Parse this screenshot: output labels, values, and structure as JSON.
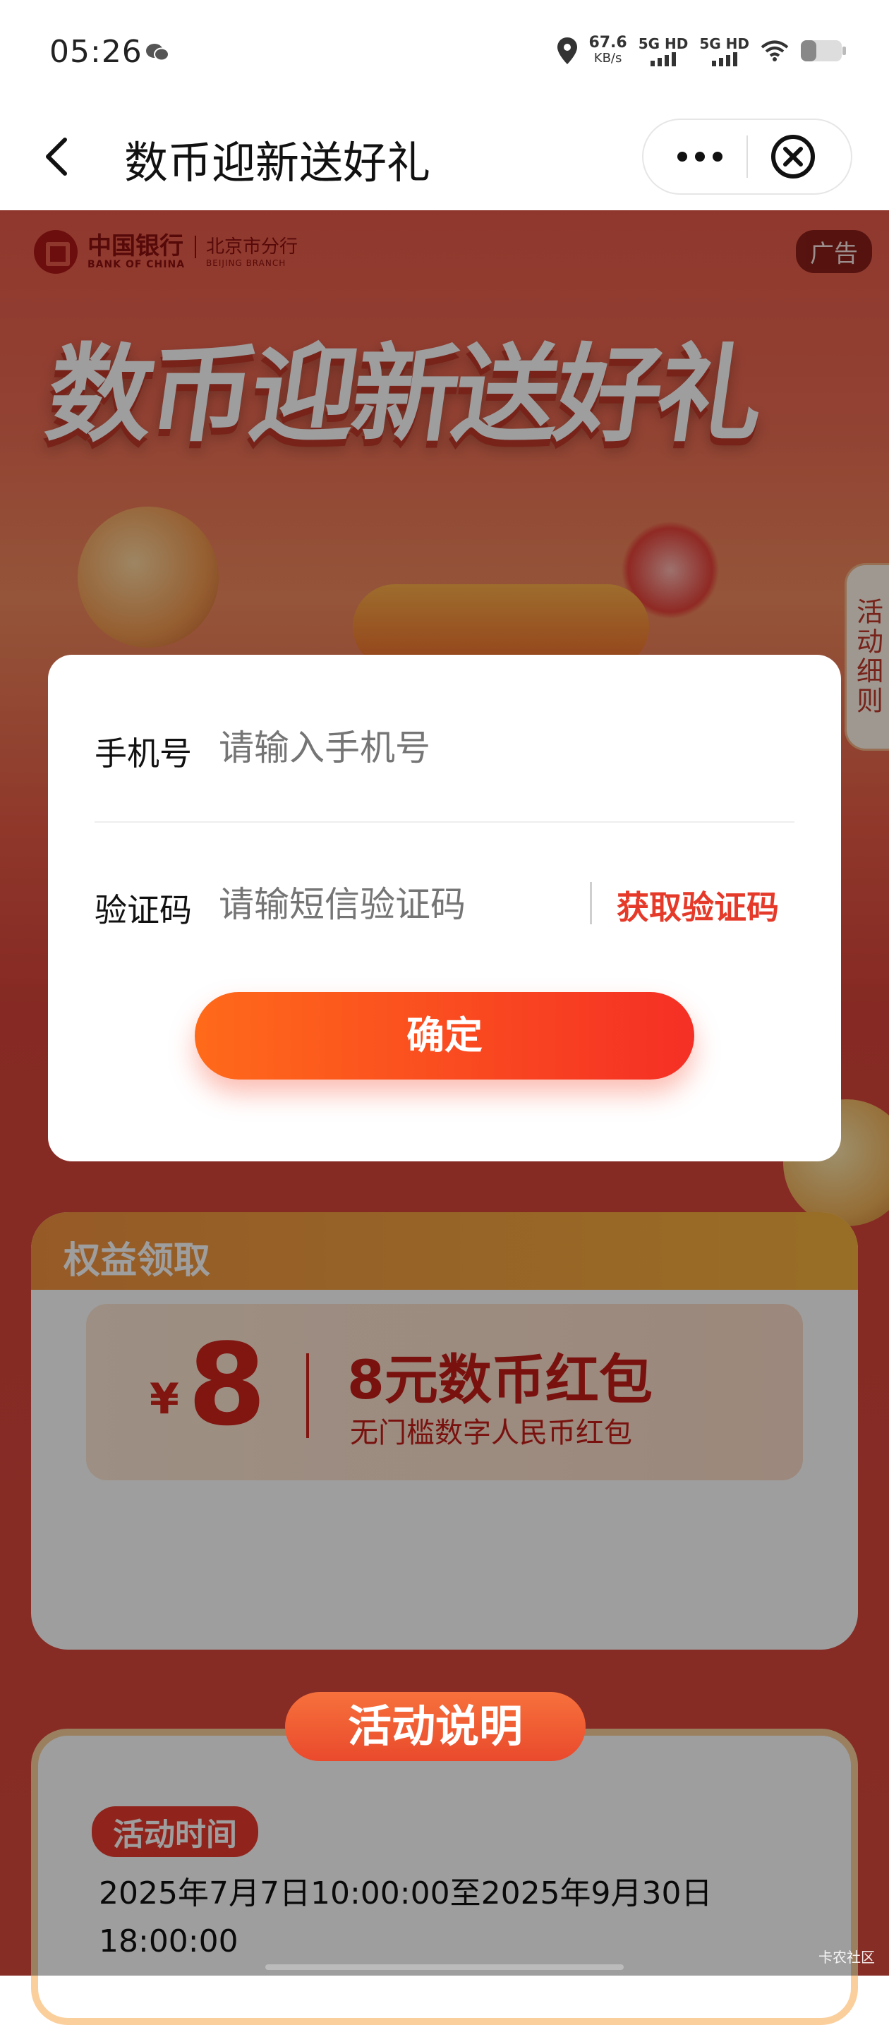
{
  "status_bar": {
    "time": "05:26",
    "net_speed_value": "67.6",
    "net_speed_unit": "KB/s",
    "sim1": "5G HD",
    "sim2": "5G HD",
    "icons": [
      "wechat-icon",
      "location-icon",
      "signal-icon",
      "wifi-icon",
      "battery-icon"
    ]
  },
  "titlebar": {
    "title": "数币迎新送好礼"
  },
  "banner": {
    "bank_name_cn": "中国银行",
    "bank_name_en": "BANK OF CHINA",
    "branch_cn": "北京市分行",
    "branch_en": "BEIJING BRANCH",
    "ad_label": "广告",
    "hero_title": "数币迎新送好礼",
    "side_tab": "活动细则"
  },
  "form": {
    "phone_label": "手机号",
    "phone_placeholder": "请输入手机号",
    "code_label": "验证码",
    "code_placeholder": "请输短信验证码",
    "get_code": "获取验证码",
    "confirm": "确定"
  },
  "rights": {
    "title": "权益领取",
    "currency": "¥",
    "amount": "8",
    "coupon_name": "8元数币红包",
    "coupon_desc": "无门槛数字人民币红包"
  },
  "activity": {
    "title": "活动说明",
    "time_badge": "活动时间",
    "time_text": "2025年7月7日10:00:00至2025年9月30日18:00:00"
  },
  "watermark": "卡农社区",
  "colors": {
    "accent_red": "#e53a2a",
    "button_start": "#ff6a1a",
    "button_end": "#f52f25"
  }
}
